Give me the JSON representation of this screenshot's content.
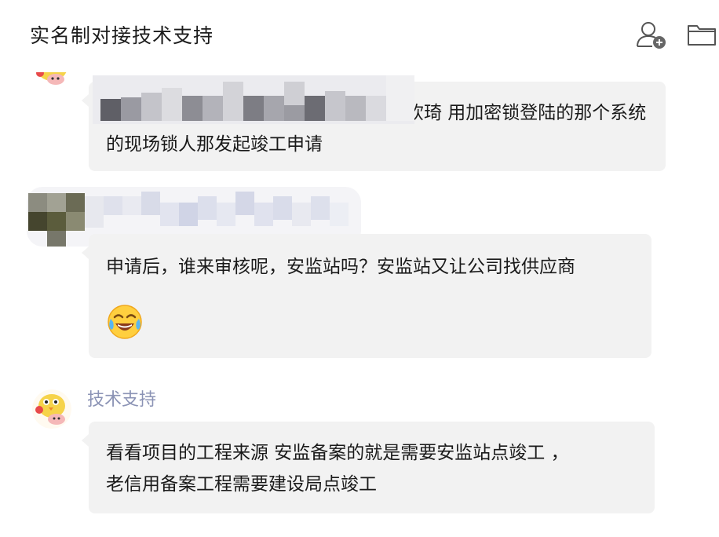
{
  "header": {
    "title": "实名制对接技术支持",
    "add_member_icon": "add-member-icon",
    "folder_icon": "folder-icon"
  },
  "messages": [
    {
      "sender": "",
      "lines": [
        "钦琦 用加密锁登陆的那个系统",
        "的现场锁人那发起竣工申请"
      ],
      "redacted_prefix": true
    },
    {
      "sender": "",
      "lines": [
        "申请后，谁来审核呢，安监站吗？安监站又让公司找供应商"
      ],
      "emoji": "tears-of-joy-emoji"
    },
    {
      "sender": "技术支持",
      "lines": [
        "看看项目的工程来源  安监备案的就是需要安监站点竣工 ，",
        "老信用备案工程需要建设局点竣工"
      ]
    }
  ],
  "colors": {
    "bubble": "#f2f2f2",
    "sender_name": "#8b93b5",
    "background": "#ffffff"
  }
}
